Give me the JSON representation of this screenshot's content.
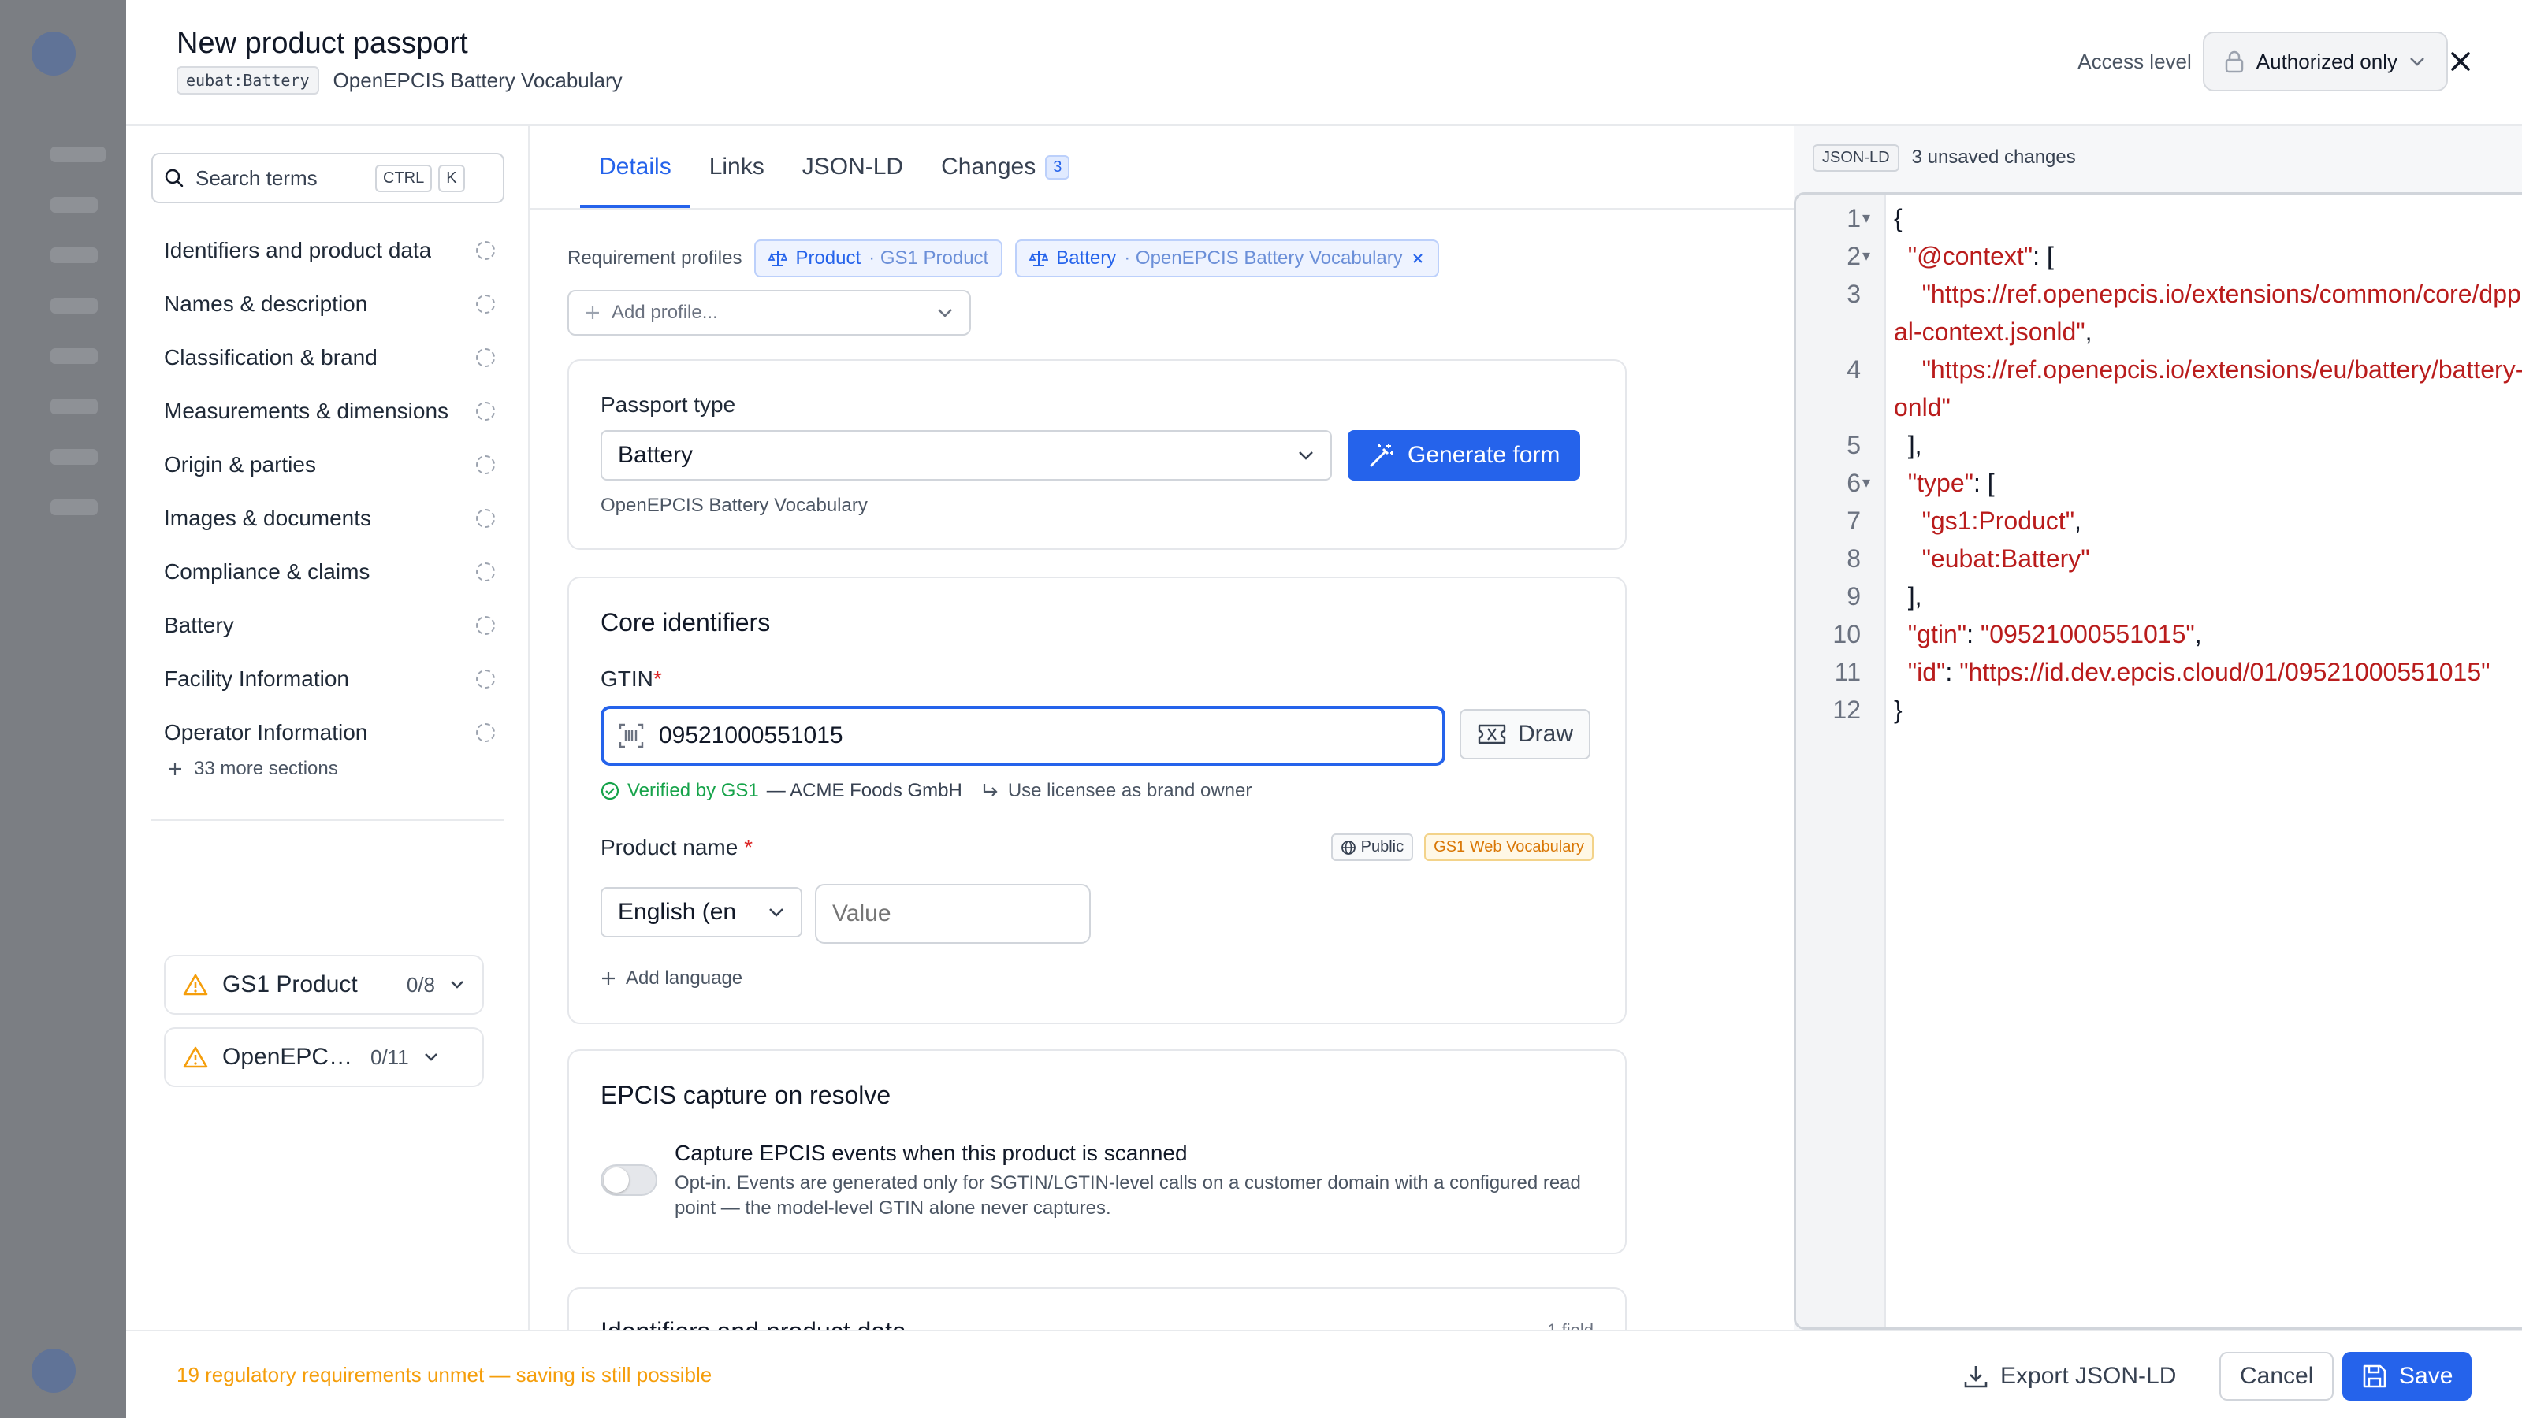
{
  "header": {
    "title": "New product passport",
    "code_chip": "eubat:Battery",
    "vocabulary": "OpenEPCIS Battery Vocabulary",
    "access_label": "Access level",
    "access_value": "Authorized only"
  },
  "sidebar": {
    "search_placeholder": "Search terms",
    "kbd_ctrl": "CTRL",
    "kbd_k": "K",
    "items": [
      {
        "label": "Identifiers and product data"
      },
      {
        "label": "Names & description"
      },
      {
        "label": "Classification & brand"
      },
      {
        "label": "Measurements & dimensions"
      },
      {
        "label": "Origin & parties"
      },
      {
        "label": "Images & documents"
      },
      {
        "label": "Compliance & claims"
      },
      {
        "label": "Battery"
      },
      {
        "label": "Facility Information"
      },
      {
        "label": "Operator Information"
      }
    ],
    "more_sections": "33 more sections",
    "requirements": [
      {
        "name": "GS1 Product",
        "count": "0/8"
      },
      {
        "name": "OpenEPCIS Battery Vocabulary",
        "count": "0/11"
      }
    ]
  },
  "tabs": [
    {
      "label": "Details"
    },
    {
      "label": "Links"
    },
    {
      "label": "JSON-LD"
    },
    {
      "label": "Changes",
      "badge": "3"
    }
  ],
  "profiles": {
    "label": "Requirement profiles",
    "chips": [
      {
        "name": "Product",
        "sub": "· GS1 Product"
      },
      {
        "name": "Battery",
        "sub": "· OpenEPCIS Battery Vocabulary"
      }
    ],
    "add_placeholder": "Add profile..."
  },
  "passport_type": {
    "heading": "Passport type",
    "value": "Battery",
    "generate_label": "Generate form",
    "hint": "OpenEPCIS Battery Vocabulary"
  },
  "core": {
    "heading": "Core identifiers",
    "gtin_label": "GTIN",
    "required_mark": "*",
    "gtin_value": "09521000551015",
    "draw_label": "Draw",
    "verified_prefix": "Verified by GS1",
    "verified_company": "— ACME Foods GmbH",
    "licensee_hint": "Use licensee as brand owner",
    "product_name_label": "Product name",
    "tag_public": "Public",
    "tag_vocab": "GS1 Web Vocabulary",
    "language_value": "English (en",
    "value_placeholder": "Value",
    "add_language": "Add language"
  },
  "epcis": {
    "heading": "EPCIS capture on resolve",
    "toggle_title": "Capture EPCIS events when this product is scanned",
    "toggle_desc": "Opt-in. Events are generated only for SGTIN/LGTIN-level calls on a customer domain with a configured read point — the model-level GTIN alone never captures."
  },
  "next_card": {
    "heading": "Identifiers and product data",
    "meta": "1 field"
  },
  "json_panel": {
    "chip": "JSON-LD",
    "status": "3 unsaved changes",
    "lines": [
      {
        "n": "1",
        "fold": "▾",
        "text": "{"
      },
      {
        "n": "2",
        "fold": "▾",
        "key": "\"@context\"",
        "text": ": ["
      },
      {
        "n": "3",
        "fold": "",
        "str": "\"https://ref.openepcis.io/extensions/common/core/dpp-operational-context.jsonld\"",
        "text": ","
      },
      {
        "n": "4",
        "fold": "",
        "str": "\"https://ref.openepcis.io/extensions/eu/battery/battery-context.jsonld\"",
        "text": ""
      },
      {
        "n": "5",
        "fold": "",
        "text": "],"
      },
      {
        "n": "6",
        "fold": "▾",
        "key": "\"type\"",
        "text": ": ["
      },
      {
        "n": "7",
        "fold": "",
        "str": "\"gs1:Product\"",
        "text": ","
      },
      {
        "n": "8",
        "fold": "",
        "str": "\"eubat:Battery\"",
        "text": ""
      },
      {
        "n": "9",
        "fold": "",
        "text": "],"
      },
      {
        "n": "10",
        "fold": "",
        "key": "\"gtin\"",
        "text": ": ",
        "str2": "\"09521000551015\"",
        "tail": ","
      },
      {
        "n": "11",
        "fold": "",
        "key": "\"id\"",
        "text": ": ",
        "str2": "\"https://id.dev.epcis.cloud/01/09521000551015\"",
        "tail": ""
      },
      {
        "n": "12",
        "fold": "",
        "text": "}"
      }
    ]
  },
  "footer": {
    "warning": "19 regulatory requirements unmet — saving is still possible",
    "export_label": "Export JSON-LD",
    "cancel_label": "Cancel",
    "save_label": "Save"
  },
  "colors": {
    "accent": "#2563eb",
    "warning": "#f59e0b",
    "json_string": "#b91c1c"
  }
}
